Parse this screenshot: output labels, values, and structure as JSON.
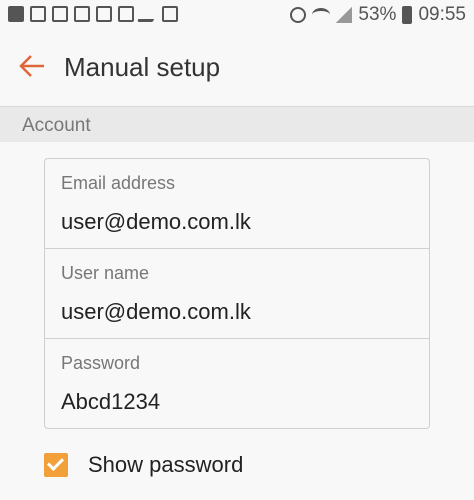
{
  "status_bar": {
    "battery_text": "53%",
    "time": "09:55",
    "icons_left": [
      "facebook-icon",
      "mail-icon",
      "mail-icon",
      "mail-icon",
      "gallery-icon",
      "mail-icon",
      "missed-call-icon",
      "location-icon"
    ],
    "icons_right": [
      "alarm-icon",
      "wifi-icon",
      "signal-icon",
      "battery-icon"
    ]
  },
  "header": {
    "title": "Manual setup",
    "accent_color": "#e0663a"
  },
  "section": {
    "title": "Account"
  },
  "form": {
    "email": {
      "label": "Email address",
      "value": "user@demo.com.lk"
    },
    "username": {
      "label": "User name",
      "value": "user@demo.com.lk"
    },
    "password": {
      "label": "Password",
      "value": "Abcd1234"
    }
  },
  "show_password": {
    "label": "Show password",
    "checked": true,
    "color": "#f2a13a"
  }
}
